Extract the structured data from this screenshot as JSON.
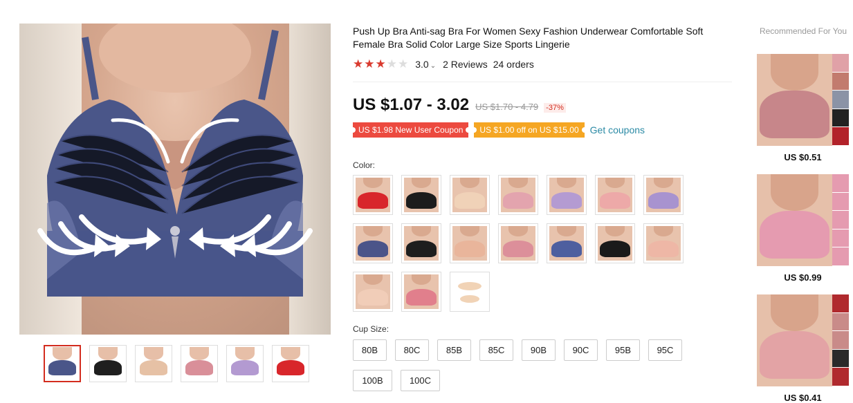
{
  "product": {
    "title": "Push Up Bra Anti-sag Bra For Women Sexy Fashion Underwear Comfortable Soft Female Bra Solid Color Large Size Sports Lingerie",
    "rating_value": "3.0",
    "rating_stars": 3,
    "rating_max": 5,
    "reviews": "2 Reviews",
    "orders": "24 orders",
    "price": "US $1.07 - 3.02",
    "old_price": "US $1.70 - 4.79",
    "discount": "-37%"
  },
  "coupons": {
    "new_user": "US $1.98 New User Coupon",
    "off": "US $1.00 off on US $15.00",
    "get_link": "Get coupons"
  },
  "labels": {
    "color": "Color:",
    "cup_size": "Cup Size:"
  },
  "gallery": {
    "thumbnails": [
      {
        "color": "#4a5689"
      },
      {
        "color": "#1f1f1f"
      },
      {
        "color": "#e6c1a5"
      },
      {
        "color": "#d98f99"
      },
      {
        "color": "#b39ad1"
      },
      {
        "color": "#d8262b"
      }
    ],
    "selected_index": 0
  },
  "colors": [
    {
      "color": "#d8262b"
    },
    {
      "color": "#1c1c1c"
    },
    {
      "color": "#f0d2b8"
    },
    {
      "color": "#e3a4ae"
    },
    {
      "color": "#b49bd2"
    },
    {
      "color": "#eda9a8"
    },
    {
      "color": "#a893cf"
    },
    {
      "color": "#4b5489"
    },
    {
      "color": "#1e1e1e"
    },
    {
      "color": "#e9b59b"
    },
    {
      "color": "#dc8f9a"
    },
    {
      "color": "#4e5f9f"
    },
    {
      "color": "#1a1a1a"
    },
    {
      "color": "#eeb7a6"
    },
    {
      "color": "#f1cdb8"
    },
    {
      "color": "#e17f8c"
    },
    {
      "color": "pad"
    }
  ],
  "sizes": [
    "80B",
    "80C",
    "85B",
    "85C",
    "90B",
    "90C",
    "95B",
    "95C",
    "100B",
    "100C"
  ],
  "recommended": {
    "title": "Recommended For You",
    "items": [
      {
        "price": "US $0.51",
        "color": "#c7868a",
        "strip": [
          "#e0a1a7",
          "#c27b6e",
          "#8b93a6",
          "#222222",
          "#b2222a"
        ]
      },
      {
        "price": "US $0.99",
        "color": "#e59bb0",
        "strip": [
          "#e59bb0",
          "#e59bb0",
          "#e59bb0",
          "#e59bb0",
          "#e59bb0"
        ]
      },
      {
        "price": "US $0.41",
        "color": "#e3a3a5",
        "strip": [
          "#b02a2e",
          "#c98b89",
          "#c98b89",
          "#2a2a2a",
          "#b02a2e"
        ]
      }
    ]
  },
  "icons": {
    "rating_caret": "chevron-down-icon",
    "star": "star-icon"
  },
  "theme": {
    "star_color": "#d93a2e",
    "coupon_red": "#ec4a3f",
    "coupon_orange": "#f5a623",
    "link_color": "#2b8aa5",
    "discount_color": "#d32c1e",
    "main_image_bra_color": "#4a5689"
  }
}
